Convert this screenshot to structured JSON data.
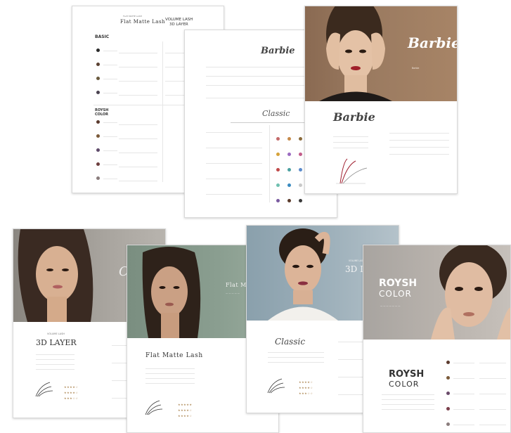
{
  "sheet1": {
    "subtitle_small": "FLAT MATTE LASH",
    "title_left": "Flat Matte Lash",
    "title_right_1": "VOLUME LASH",
    "title_right_2": "3D LAYER",
    "basic_label": "BASIC",
    "roysh_label_1": "ROYSH",
    "roysh_label_2": "COLOR",
    "basic_colors": [
      "#2b2b2b",
      "#5a4132",
      "#6a5a3e",
      "#4a4250"
    ],
    "roysh_colors": [
      "#5b3b2e",
      "#7b5a3a",
      "#5f4b6b",
      "#6d3f3f",
      "#8a7d7d"
    ]
  },
  "sheet2": {
    "brand": "Barbie",
    "classic": "Classic",
    "dot_rows": [
      [
        "#c46a6a",
        "#c68a4a",
        "#8a6a3a"
      ],
      [
        "#d6a23a",
        "#9b6bc1",
        "#c25c8a"
      ],
      [
        "#c04a4a",
        "#4aa0a0",
        "#5a8acb"
      ],
      [
        "#6fc0b0",
        "#3a8ac0",
        "#c8c8c8"
      ],
      [
        "#7a5aa0",
        "#5a3a2a",
        "#3a3a3a"
      ]
    ]
  },
  "sheet3": {
    "brand_photo": "Barbie",
    "brand_panel": "Barbie",
    "tagline": "Barbie "
  },
  "bottom1": {
    "subtitle": "VOLUME LASH",
    "title": "3D LAYER",
    "partial_title": "C"
  },
  "bottom2": {
    "title": "Flat Matte Lash",
    "photo_title": "Flat Matte"
  },
  "bottom3": {
    "photo_subtitle": "VOLUME LASH",
    "photo_title": "3D LA",
    "script_title": "Classic"
  },
  "bottom4": {
    "photo_title_1": "ROYSH",
    "photo_title_2": "COLOR",
    "panel_title_1": "ROYSH",
    "panel_title_2": "COLOR",
    "dot_colors": [
      "#5b3b2e",
      "#7b5a3a",
      "#6a4a6a",
      "#7b3f4b",
      "#8a7d7d"
    ]
  }
}
